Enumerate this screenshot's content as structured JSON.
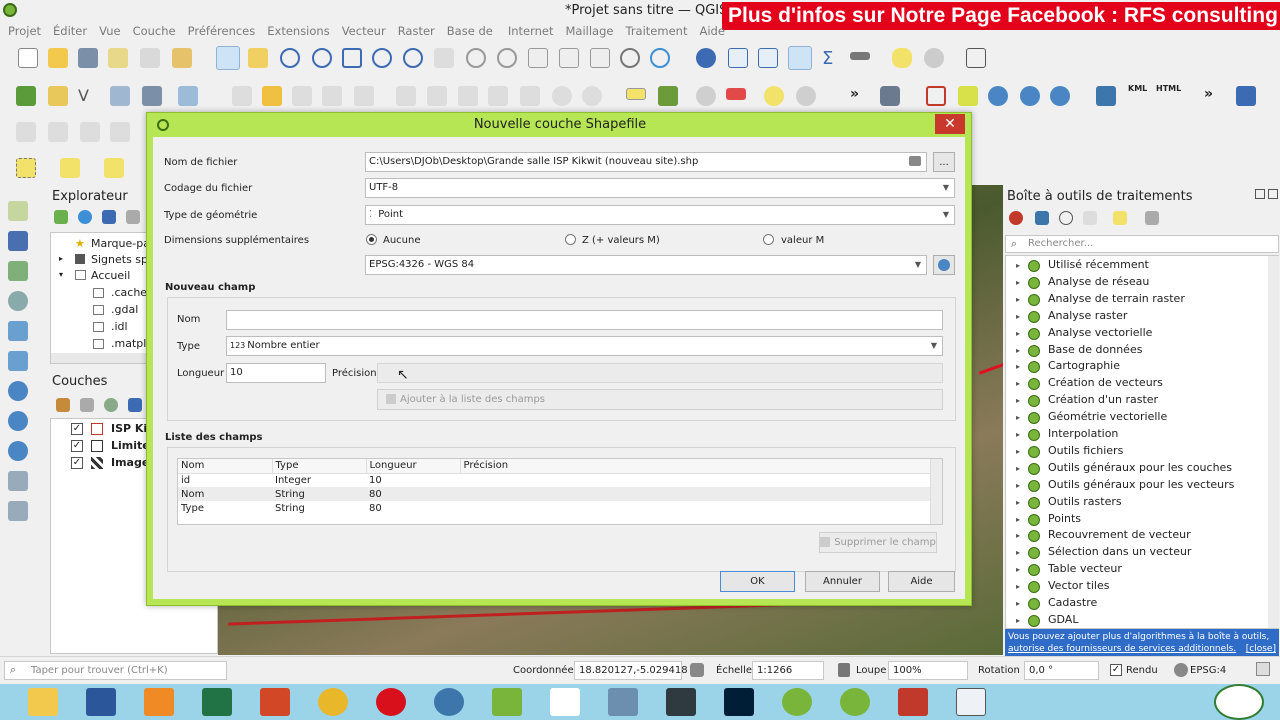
{
  "app": {
    "title": "*Projet sans titre — QGIS",
    "banner": "Plus d'infos sur Notre Page Facebook : RFS consulting"
  },
  "menu": [
    "Projet",
    "Éditer",
    "Vue",
    "Couche",
    "Préférences",
    "Extensions",
    "Vecteur",
    "Raster",
    "Base de données",
    "Internet",
    "Maillage",
    "Traitement",
    "Aide"
  ],
  "browser": {
    "title": "Explorateur",
    "items": [
      "Marque-pa",
      "Signets spa",
      "Accueil",
      ".cache",
      ".gdal",
      ".idl",
      ".matplo"
    ]
  },
  "layers": {
    "title": "Couches",
    "items": [
      {
        "label": "ISP Kik",
        "checked": true
      },
      {
        "label": "Limite",
        "checked": true
      },
      {
        "label": "Image",
        "checked": true
      }
    ]
  },
  "dialog": {
    "title": "Nouvelle couche Shapefile",
    "close": "✕",
    "filename_label": "Nom de fichier",
    "filename_value": "C:\\Users\\DJOb\\Desktop\\Grande salle ISP Kikwit (nouveau site).shp",
    "browse_label": "...",
    "encoding_label": "Codage du fichier",
    "encoding_value": "UTF-8",
    "geometry_label": "Type de géométrie",
    "geometry_value": "Point",
    "dimensions_label": "Dimensions supplémentaires",
    "dim_none": "Aucune",
    "dim_z": "Z (+ valeurs M)",
    "dim_m": "valeur M",
    "crs_value": "EPSG:4326 - WGS 84",
    "new_field_title": "Nouveau champ",
    "name_label": "Nom",
    "name_value": "",
    "type_label": "Type",
    "type_prefix": "123",
    "type_value": "Nombre entier",
    "length_label": "Longueur",
    "length_value": "10",
    "precision_label": "Précision",
    "precision_value": "",
    "add_button": "Ajouter à la liste des champs",
    "field_list_title": "Liste des champs",
    "columns": [
      "Nom",
      "Type",
      "Longueur",
      "Précision"
    ],
    "rows": [
      [
        "id",
        "Integer",
        "10",
        ""
      ],
      [
        "Nom",
        "String",
        "80",
        ""
      ],
      [
        "Type",
        "String",
        "80",
        ""
      ]
    ],
    "delete_button": "Supprimer le champ",
    "ok": "OK",
    "cancel": "Annuler",
    "help": "Aide"
  },
  "toolbox": {
    "title": "Boîte à outils de traitements",
    "search_placeholder": "Rechercher...",
    "items": [
      "Utilisé récemment",
      "Analyse de réseau",
      "Analyse de terrain raster",
      "Analyse raster",
      "Analyse vectorielle",
      "Base de données",
      "Cartographie",
      "Création de vecteurs",
      "Création d'un raster",
      "Géométrie vectorielle",
      "Interpolation",
      "Outils fichiers",
      "Outils généraux pour les couches",
      "Outils généraux pour les vecteurs",
      "Outils rasters",
      "Points",
      "Recouvrement de vecteur",
      "Sélection dans un vecteur",
      "Table vecteur",
      "Vector tiles",
      "Cadastre",
      "GDAL"
    ],
    "info_text": "Vous pouvez ajouter plus d'algorithmes à la boîte à outils,",
    "info_link": "autorise des fournisseurs de services additionnels.",
    "info_close": "[close]"
  },
  "status": {
    "locator_placeholder": "Taper pour trouver (Ctrl+K)",
    "coord_label": "Coordonnée",
    "coord_value": "18.820127,-5.029418",
    "scale_label": "Échelle",
    "scale_value": "1:1266",
    "magnifier_label": "Loupe",
    "magnifier_value": "100%",
    "rotation_label": "Rotation",
    "rotation_value": "0,0 °",
    "render_label": "Rendu",
    "crs_value": "EPSG:4"
  },
  "colors": {
    "dialog_frame": "#b6e653",
    "close_button": "#c8382d",
    "banner": "#e3001b",
    "taskbar": "#9bd3e9"
  }
}
